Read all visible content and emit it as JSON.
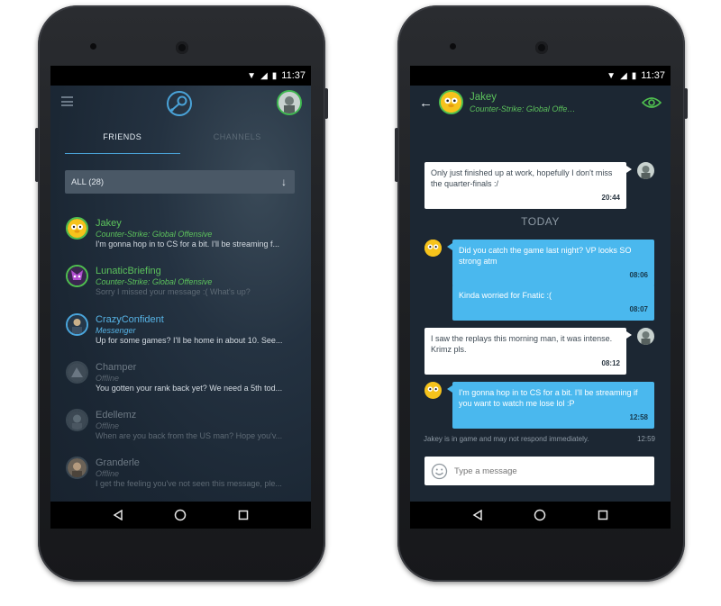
{
  "left_phone": {
    "status": {
      "time": "11:37"
    },
    "tabs": [
      {
        "label": "FRIENDS",
        "active": true
      },
      {
        "label": "CHANNELS",
        "active": false
      }
    ],
    "filter": {
      "label": "ALL (28)"
    },
    "friends": [
      {
        "name": "Jakey",
        "status": "Counter-Strike: Global Offensive",
        "message": "I'm gonna hop in to CS for a bit. I'll be streaming f...",
        "state": "ingame",
        "avatar": "jake-avatar"
      },
      {
        "name": "LunaticBriefing",
        "status": "Counter-Strike: Global Offensive",
        "message": "Sorry I missed your message :( What's up?",
        "state": "ingame",
        "avatar": "lunatic-avatar"
      },
      {
        "name": "CrazyConfident",
        "status": "Messenger",
        "message": "Up for some games? I'll be home in about 10. See...",
        "state": "online",
        "avatar": "crazy-avatar"
      },
      {
        "name": "Champer",
        "status": "Offline",
        "message": "You gotten your rank back yet? We need a 5th tod...",
        "state": "offline",
        "avatar": "champer-avatar"
      },
      {
        "name": "Edellemz",
        "status": "Offline",
        "message": "When are you back from the US man? Hope you'v...",
        "state": "offline",
        "avatar": "edellemz-avatar"
      },
      {
        "name": "Granderle",
        "status": "Offline",
        "message": "I get the feeling you've not seen this message, ple...",
        "state": "offline",
        "avatar": "granderle-avatar"
      }
    ]
  },
  "right_phone": {
    "status": {
      "time": "11:37"
    },
    "header": {
      "name": "Jakey",
      "game": "Counter-Strike: Global Offensive"
    },
    "messages": [
      {
        "text": "Only just finished up at work, hopefully I don't miss the quarter-finals :/",
        "time": "20:44",
        "from": "me"
      },
      {
        "text": "Did you catch the game last night? VP looks SO strong atm",
        "time": "08:06",
        "from": "friend"
      },
      {
        "text": "Kinda worried for Fnatic :(",
        "time": "08:07",
        "from": "friend"
      },
      {
        "text": "I saw the replays this morning man, it was intense. Krimz pls.",
        "time": "08:12",
        "from": "me"
      },
      {
        "text": "I'm gonna hop in to CS for a bit. I'll be streaming if you want to watch me lose lol :P",
        "time": "12:58",
        "from": "friend"
      }
    ],
    "divider": "TODAY",
    "notice": "Jakey is in game and may not respond immediately.",
    "notice_time": "12:59",
    "input_placeholder": "Type a message"
  },
  "colors": {
    "ingame": "#5cc25c",
    "online": "#57b4e6",
    "offline": "#6e7a85",
    "bubble_blue": "#4ab8ee",
    "accent_tab": "#4aa3d8"
  }
}
